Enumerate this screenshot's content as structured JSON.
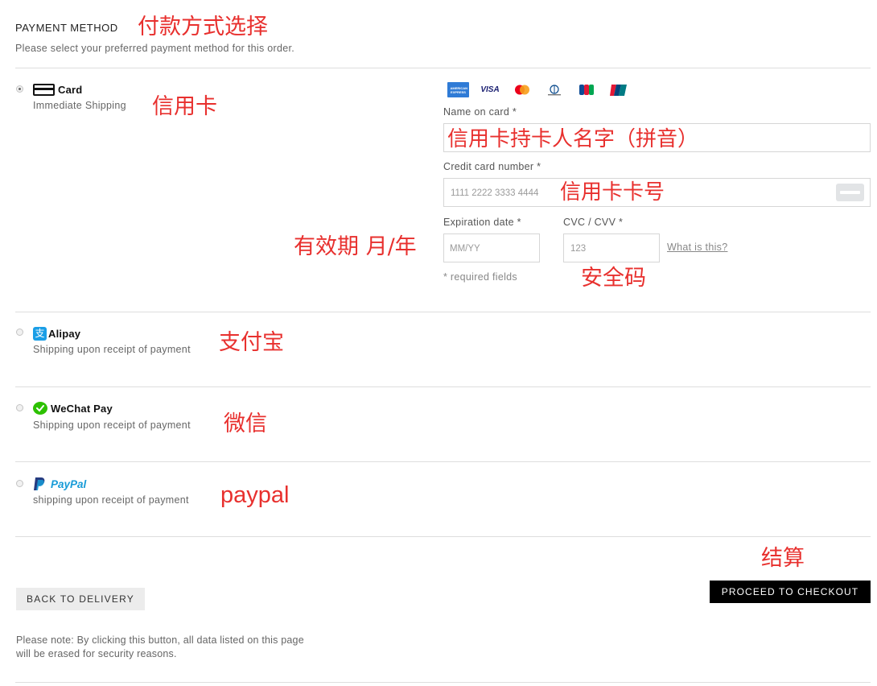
{
  "header": {
    "title": "PAYMENT METHOD",
    "title_note": "付款方式选择",
    "subtitle": "Please select your preferred payment method for this order."
  },
  "methods": [
    {
      "name": "Card",
      "desc": "Immediate Shipping",
      "note": "信用卡",
      "selected": true,
      "icon": "card-icon"
    },
    {
      "name": "Alipay",
      "desc": "Shipping upon receipt of payment",
      "note": "支付宝",
      "selected": false,
      "icon": "alipay-icon"
    },
    {
      "name": "WeChat Pay",
      "desc": "Shipping upon receipt of payment",
      "note": "微信",
      "selected": false,
      "icon": "wechat-icon"
    },
    {
      "name": "PayPal",
      "desc": "shipping upon receipt of payment",
      "note": "paypal",
      "selected": false,
      "icon": "paypal-icon"
    }
  ],
  "card_form": {
    "logos": [
      "amex-logo",
      "visa-logo",
      "mastercard-logo",
      "diners-club-logo",
      "jcb-logo",
      "unionpay-logo"
    ],
    "visa_text": "VISA",
    "amex_text": "AMERICAN EXPRESS",
    "jcb_text": "JCB",
    "name_label": "Name on card *",
    "name_note": "信用卡持卡人名字（拼音）",
    "number_label": "Credit card number *",
    "number_placeholder": "1111 2222 3333 4444",
    "number_note": "信用卡卡号",
    "expiry_label": "Expiration date *",
    "expiry_placeholder": "MM/YY",
    "expiry_note": "有效期 月/年",
    "cvc_label": "CVC / CVV *",
    "cvc_placeholder": "123",
    "cvc_help": "What is this?",
    "cvc_note": "安全码",
    "required_note": "* required fields"
  },
  "footer": {
    "back_label": "BACK TO DELIVERY",
    "checkout_label": "PROCEED TO CHECKOUT",
    "checkout_note": "结算",
    "notice": "Please note: By clicking this button, all data listed on this page will be erased for security reasons."
  },
  "colors": {
    "annotation": "#e8302e",
    "divider": "#dedede",
    "checkout_bg": "#000000",
    "alipay": "#1a9ee6",
    "wechat": "#2dc100",
    "paypal_dark": "#253b80",
    "paypal_light": "#179bd7"
  }
}
